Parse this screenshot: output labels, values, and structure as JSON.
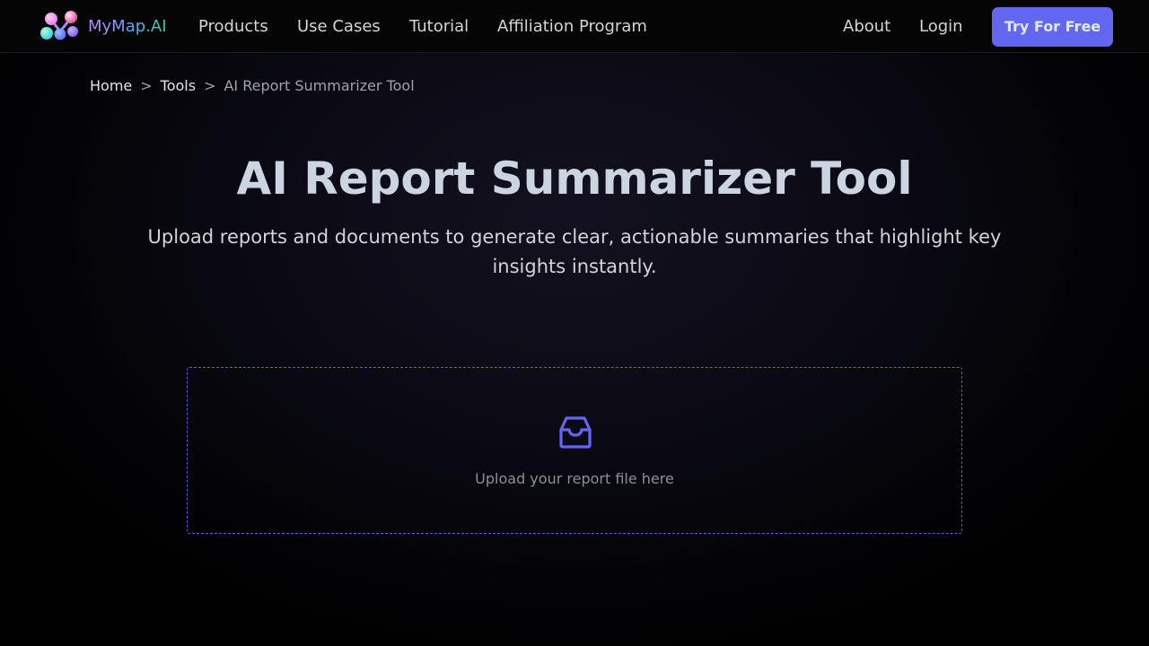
{
  "header": {
    "brand": "MyMap.AI",
    "logo_icon": "mymap-logo-icon",
    "nav_left": {
      "products": "Products",
      "use_cases": "Use Cases",
      "tutorial": "Tutorial",
      "affiliation": "Affiliation Program"
    },
    "nav_right": {
      "about": "About",
      "login": "Login"
    },
    "cta_label": "Try For Free"
  },
  "breadcrumb": {
    "home": "Home",
    "tools": "Tools",
    "current": "AI Report Summarizer Tool",
    "separator": ">"
  },
  "hero": {
    "title": "AI Report Summarizer Tool",
    "subtitle": "Upload reports and documents to generate clear, actionable summaries that highlight key insights instantly."
  },
  "upload": {
    "icon": "inbox-icon",
    "text": "Upload your report file here"
  },
  "colors": {
    "accent": "#6366f1",
    "background": "#000000",
    "dropzone_border": "#5b5bd6"
  }
}
